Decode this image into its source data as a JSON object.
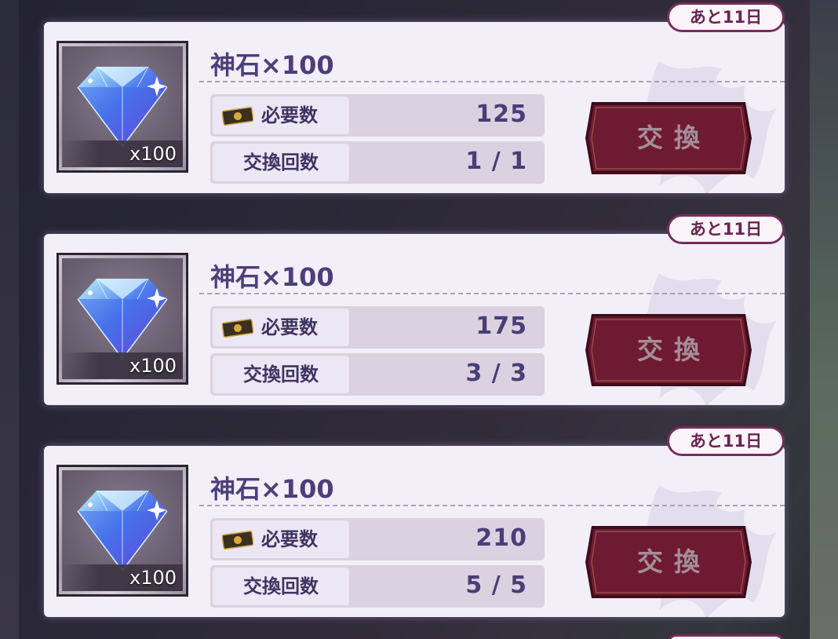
{
  "exchange_items": [
    {
      "time_remaining": "あと11日",
      "title": "神石×100",
      "thumbnail_qty": "x100",
      "required_label": "必要数",
      "required_value": "125",
      "count_label": "交換回数",
      "count_value": "1 / 1",
      "button_label": "交換"
    },
    {
      "time_remaining": "あと11日",
      "title": "神石×100",
      "thumbnail_qty": "x100",
      "required_label": "必要数",
      "required_value": "175",
      "count_label": "交換回数",
      "count_value": "3 / 3",
      "button_label": "交換"
    },
    {
      "time_remaining": "あと11日",
      "title": "神石×100",
      "thumbnail_qty": "x100",
      "required_label": "必要数",
      "required_value": "210",
      "count_label": "交換回数",
      "count_value": "5 / 5",
      "button_label": "交換"
    }
  ],
  "icons": {
    "item_icon": "diamond-icon",
    "currency_icon": "ticket-icon"
  },
  "colors": {
    "card_bg": "#f2eff9",
    "badge_border": "#7a2a5e",
    "title_text": "#4c3f7a",
    "button_fill": "#6e1a33"
  }
}
